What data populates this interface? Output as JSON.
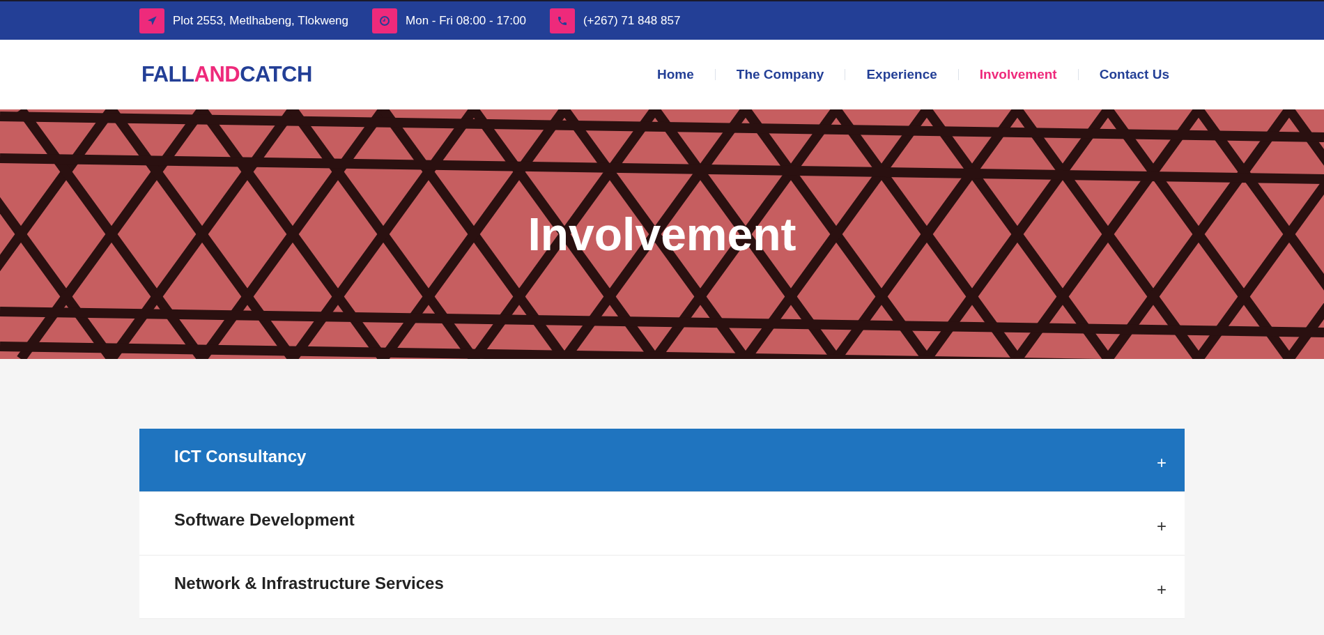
{
  "top_bar": {
    "items": [
      {
        "kind": "location",
        "text": "Plot 2553, Metlhabeng, Tlokweng"
      },
      {
        "kind": "clock",
        "text": "Mon - Fri 08:00 - 17:00"
      },
      {
        "kind": "phone",
        "text": "(+267) 71 848 857"
      }
    ]
  },
  "logo": [
    {
      "text": "FALL",
      "color": "#233f96"
    },
    {
      "text": "AND",
      "color": "#ee2a7b"
    },
    {
      "text": "CATCH",
      "color": "#233f96"
    }
  ],
  "nav": [
    {
      "label": "Home",
      "selected": false
    },
    {
      "label": "The Company",
      "selected": false
    },
    {
      "label": "Experience",
      "selected": false
    },
    {
      "label": "Involvement",
      "selected": true
    },
    {
      "label": "Contact Us",
      "selected": false
    }
  ],
  "hero": {
    "title": "Involvement"
  },
  "accordion": [
    {
      "title": "ICT Consultancy",
      "toggle": "+",
      "selected": true
    },
    {
      "title": "Software Development",
      "toggle": "+",
      "selected": false
    },
    {
      "title": "Network & Infrastructure Services",
      "toggle": "+",
      "selected": false
    }
  ]
}
